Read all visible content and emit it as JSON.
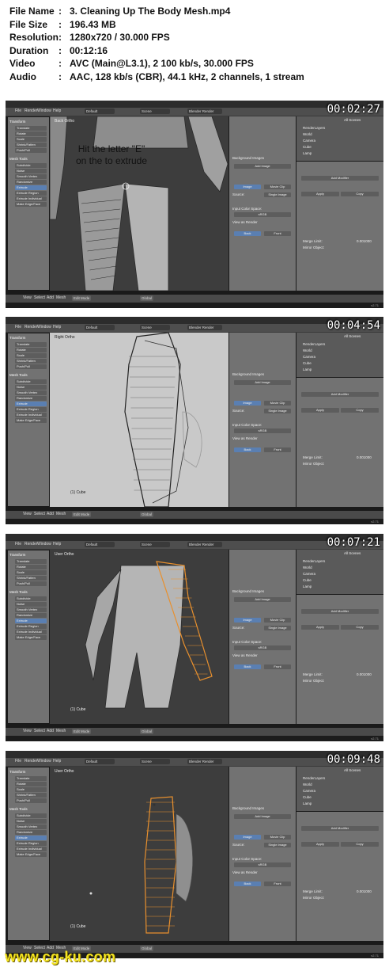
{
  "file_info": {
    "rows": [
      {
        "key": "File Name",
        "value": "3. Cleaning Up The Body Mesh.mp4"
      },
      {
        "key": "File Size",
        "value": "196.43 MB"
      },
      {
        "key": "Resolution",
        "value": "1280x720 / 30.000 FPS"
      },
      {
        "key": "Duration",
        "value": "00:12:16"
      },
      {
        "key": "Video",
        "value": "AVC (Main@L3.1), 2 100 kb/s, 30.000 FPS"
      },
      {
        "key": "Audio",
        "value": "AAC, 128 kb/s (CBR), 44.1 kHz, 2 channels, 1 stream"
      }
    ],
    "separator": ":"
  },
  "frames": [
    {
      "timestamp": "00:02:27",
      "view_label": "Back Ortho",
      "overlay_text": "Hit the letter \"E\" on the to extrude",
      "mode": "Edit Mode",
      "object_label": "",
      "viewport": "dark"
    },
    {
      "timestamp": "00:04:54",
      "view_label": "Right Ortho",
      "overlay_text": "",
      "mode": "Edit Mode",
      "object_label": "(1) Cube",
      "viewport": "light"
    },
    {
      "timestamp": "00:07:21",
      "view_label": "User Ortho",
      "overlay_text": "",
      "mode": "Edit Mode",
      "object_label": "(1) Cube",
      "viewport": "dark"
    },
    {
      "timestamp": "00:09:48",
      "view_label": "User Ortho",
      "overlay_text": "",
      "mode": "Edit Mode",
      "object_label": "(1) Cube",
      "viewport": "dark"
    }
  ],
  "ui": {
    "menu": [
      "File",
      "Render",
      "Window",
      "Help"
    ],
    "layout": "Default",
    "scene": "Scene",
    "render_engine": "Blender Render",
    "bottom_menu": [
      "View",
      "Select",
      "Add",
      "Mesh"
    ],
    "pivot": "Global",
    "tool_header": "Transform",
    "tools": [
      "Translate",
      "Rotate",
      "Scale",
      "Shrink/Fatten",
      "Push/Pull"
    ],
    "mesh_tools_header": "Mesh Tools",
    "mesh_tools": [
      "Subdivide",
      "Noise",
      "Smooth Vertex",
      "Randomize",
      "Extrude",
      "Extrude Region",
      "Extrude Individual",
      "Make Edge/Face"
    ],
    "outliner_rows": [
      "RenderLayers",
      "World",
      "Camera",
      "Cube",
      "Lamp"
    ],
    "outliner_header": "All Scenes",
    "modifier_button": "Add Modifier",
    "apply": "Apply",
    "copy": "Copy",
    "merge_limit": "Merge Limit:",
    "merge_value": "0.001000",
    "mirror_object": "Mirror Object:",
    "bg_images": "Background Images",
    "add_image": "Add Image",
    "image_tab": "Image",
    "movie_tab": "Movie Clip",
    "source": "Source:",
    "single_image": "Single Image",
    "input_color": "Input Color Space:",
    "srgb": "sRGB",
    "view_render": "View as Render",
    "back": "Back",
    "front": "Front",
    "status": "v2.71"
  },
  "watermark": "www.cg-ku.com",
  "colors": {
    "selection": "#e8902e",
    "highlight": "#5a7fb2"
  }
}
